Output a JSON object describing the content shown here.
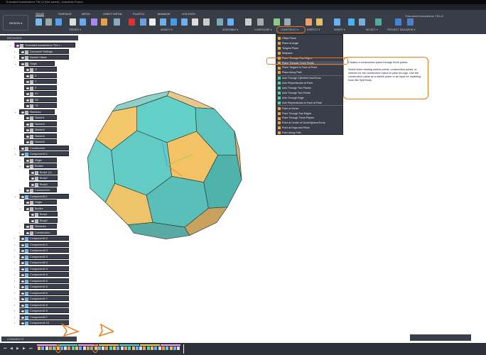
{
  "window": {
    "title": "Truncated Icosahedron TIN v2 (Not saved) - Autodesk Fusion",
    "document_title": "Truncated Icosahedron TIN v2"
  },
  "toolbar": {
    "workspace": "DESIGN ▾",
    "tabs": [
      "SOLID",
      "SURFACE",
      "MESH",
      "SHEET METAL",
      "PLASTIC",
      "MANAGE",
      "UTILITIES"
    ],
    "active_tab": "SOLID",
    "groups": [
      "CREATE ▾",
      "MODIFY ▾",
      "ASSEMBLE ▾",
      "CONFIGURE ▾",
      "CONSTRUCT ▾",
      "INSPECT ▾",
      "INSERT ▾",
      "SELECT ▾",
      "PROJECT SALVADOR ▾"
    ]
  },
  "browser": {
    "title": "BROWSER",
    "rows": [
      {
        "l": 0,
        "t": "Truncated Icosahedron TIN v...",
        "e": "v"
      },
      {
        "l": 1,
        "t": "Document Settings",
        "e": ">"
      },
      {
        "l": 1,
        "t": "Named Views",
        "e": ">"
      },
      {
        "l": 1,
        "t": "Origin",
        "e": "v"
      },
      {
        "l": 2,
        "t": "O"
      },
      {
        "l": 2,
        "t": "X"
      },
      {
        "l": 2,
        "t": "Y"
      },
      {
        "l": 2,
        "t": "Z"
      },
      {
        "l": 2,
        "t": "XY"
      },
      {
        "l": 2,
        "t": "XZ"
      },
      {
        "l": 2,
        "t": "YZ"
      },
      {
        "l": 1,
        "t": "Sketches",
        "e": "v"
      },
      {
        "l": 2,
        "t": "Sketch1"
      },
      {
        "l": 2,
        "t": "Sketch2"
      },
      {
        "l": 2,
        "t": "Sketch3"
      },
      {
        "l": 2,
        "t": "Sketch4"
      },
      {
        "l": 2,
        "t": "Sketch5"
      },
      {
        "l": 1,
        "t": "Construction",
        "e": ">"
      },
      {
        "l": 1,
        "t": "Component1:1",
        "e": "v",
        "c": "#3cc8c8"
      },
      {
        "l": 2,
        "t": "Origin",
        "e": ">"
      },
      {
        "l": 2,
        "t": "Bodies",
        "e": "v"
      },
      {
        "l": 3,
        "t": "Body1 (1)"
      },
      {
        "l": 3,
        "t": "Body2"
      },
      {
        "l": 3,
        "t": "Body3"
      },
      {
        "l": 2,
        "t": "Construction",
        "e": ">"
      },
      {
        "l": 1,
        "t": "Component2:1",
        "e": "v",
        "c": "#f0c040"
      },
      {
        "l": 2,
        "t": "Origin",
        "e": ">"
      },
      {
        "l": 2,
        "t": "Bodies",
        "e": "v"
      },
      {
        "l": 3,
        "t": "Body1"
      },
      {
        "l": 3,
        "t": "Body2"
      },
      {
        "l": 2,
        "t": "Sketches",
        "e": ">"
      },
      {
        "l": 2,
        "t": "Construction",
        "e": ">"
      },
      {
        "l": 1,
        "t": "Component2:2",
        "e": ">",
        "c": "#f0c040"
      },
      {
        "l": 1,
        "t": "Component1:2",
        "e": ">",
        "c": "#3cc8c8"
      },
      {
        "l": 1,
        "t": "Component2:3",
        "e": ">",
        "c": "#f0c040"
      },
      {
        "l": 1,
        "t": "Component1:3",
        "e": ">",
        "c": "#3cc8c8"
      },
      {
        "l": 1,
        "t": "Component2:4",
        "e": ">",
        "c": "#f0c040"
      },
      {
        "l": 1,
        "t": "Component1:4",
        "e": ">",
        "c": "#3cc8c8"
      },
      {
        "l": 1,
        "t": "Component1:5",
        "e": ">",
        "c": "#3cc8c8"
      },
      {
        "l": 1,
        "t": "Component2:5",
        "e": ">",
        "c": "#f0c040"
      },
      {
        "l": 1,
        "t": "Component1:6",
        "e": ">",
        "c": "#3cc8c8"
      },
      {
        "l": 1,
        "t": "Component2:6",
        "e": ">",
        "c": "#f0c040"
      },
      {
        "l": 1,
        "t": "Component1:7",
        "e": ">",
        "c": "#3cc8c8"
      },
      {
        "l": 1,
        "t": "Component1:8",
        "e": ">",
        "c": "#3cc8c8"
      },
      {
        "l": 1,
        "t": "Component1:9",
        "e": ">",
        "c": "#3cc8c8"
      },
      {
        "l": 1,
        "t": "Component2:7",
        "e": ">",
        "c": "#f0c040"
      },
      {
        "l": 1,
        "t": "Component1:10",
        "e": ">",
        "c": "#3cc8c8"
      }
    ]
  },
  "construct_menu": {
    "items": [
      "Offset Plane",
      "Plane at Angle",
      "Tangent Plane",
      "Midplane",
      "Plane Through Two Edges",
      "Plane Through Three Points",
      "Plane Tangent to Face at Point",
      "Plane Along Path",
      "Axis Through Cylinder/Cone/Torus",
      "Axis Perpendicular at Point",
      "Axis Through Two Planes",
      "Axis Through Two Points",
      "Axis Through Edge",
      "Axis Perpendicular to Face at Point",
      "Point at Vertex",
      "Point Through Two Edges",
      "Point Through Three Planes",
      "Point at Center of Circle/Sphere/Torus",
      "Point at Edge and Plane",
      "Point Along Path"
    ],
    "highlighted": "Plane Through Three Points"
  },
  "tooltip": {
    "title": "Creates a construction plane through three points.",
    "body": "Select three existing sketch points, construction points, or vertices for the construction plane to pass through. Use the construction plane as a sketch plane or as input for modeling tools like Split Body."
  },
  "comments": {
    "label": "COMMENTS"
  },
  "colors": {
    "accent": "#f07a1a",
    "teal": "#5ecbc4",
    "yellow": "#f2c463",
    "toolbar": "#383d48"
  }
}
